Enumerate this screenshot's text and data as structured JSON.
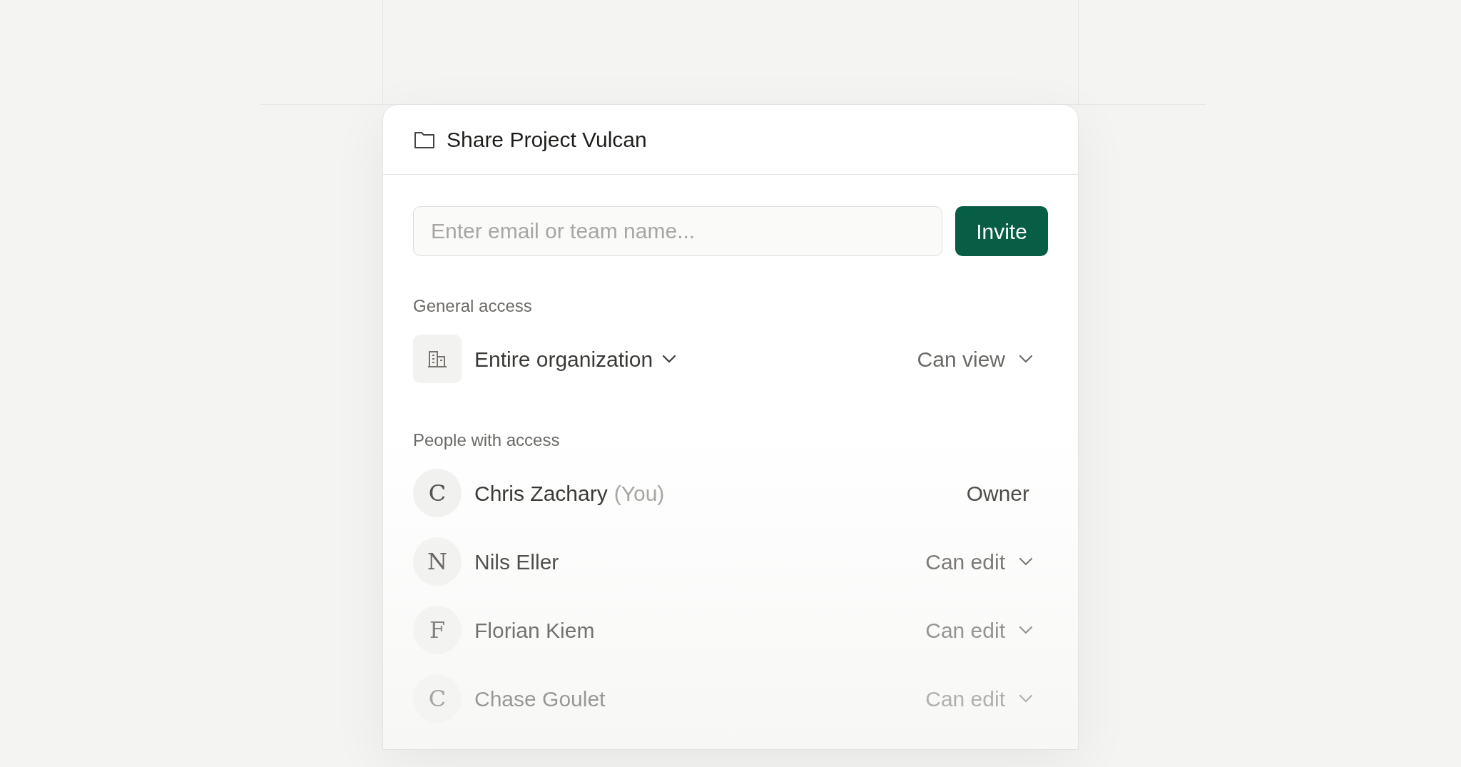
{
  "dialog": {
    "title": "Share Project Vulcan"
  },
  "invite": {
    "placeholder": "Enter email or team name...",
    "button": "Invite"
  },
  "general_access": {
    "label": "General access",
    "scope": "Entire organization",
    "permission": "Can view"
  },
  "people": {
    "label": "People with access",
    "members": [
      {
        "initial": "C",
        "name": "Chris Zachary",
        "note": "(You)",
        "role": "Owner",
        "kind": "static"
      },
      {
        "initial": "N",
        "name": "Nils Eller",
        "role": "Can edit",
        "kind": "dropdown"
      },
      {
        "initial": "F",
        "name": "Florian Kiem",
        "role": "Can edit",
        "kind": "dropdown"
      },
      {
        "initial": "C",
        "name": "Chase Goulet",
        "role": "Can edit",
        "kind": "dropdown"
      }
    ]
  }
}
